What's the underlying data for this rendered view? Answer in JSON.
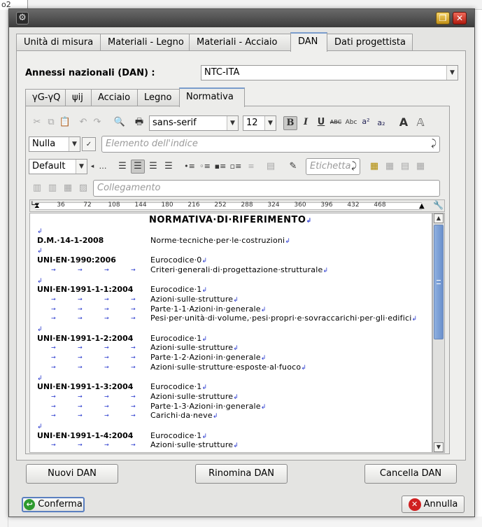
{
  "background": {
    "tab_text": "o2"
  },
  "window": {
    "icons": {
      "app": "gear-icon",
      "restore": "restore-icon",
      "close": "close-icon"
    },
    "colors": {
      "accent": "#7a9ccc",
      "thumb": "#6a90cc",
      "ok_icon": "#2e9a2e",
      "cancel_icon": "#d02020",
      "pilcrow": "#2233cc"
    }
  },
  "outer_tabs": [
    "Unità di misura",
    "Materiali - Legno",
    "Materiali - Acciaio",
    "DAN",
    "Dati progettista"
  ],
  "outer_active": "DAN",
  "annex": {
    "label": "Annessi nazionali (DAN) :",
    "value": "NTC-ITA"
  },
  "inner_tabs": [
    "γG-γQ",
    "ψij",
    "Acciaio",
    "Legno",
    "Normativa"
  ],
  "inner_active": "Normativa",
  "toolbar": {
    "font_family": "sans-serif",
    "font_size": "12",
    "bold": "B",
    "italic": "I",
    "underline": "U",
    "strike": "ABC",
    "smallcaps": "Abc",
    "superscript": "a²",
    "subscript": "a₂",
    "style": "Nulla",
    "index_placeholder": "Elemento dell'indice",
    "paragraph_style": "Default",
    "label_placeholder": "Etichetta",
    "link_placeholder": "Collegamento"
  },
  "ruler": {
    "ticks": [
      "36",
      "72",
      "108",
      "144",
      "180",
      "216",
      "252",
      "288",
      "324",
      "360",
      "396",
      "432",
      "468"
    ]
  },
  "document": {
    "title": "NORMATIVA·DI·RIFERIMENTO",
    "entries": [
      {
        "code": "D.M.·14-1-2008",
        "lines": [
          "Norme·tecniche·per·le·costruzioni"
        ]
      },
      {
        "code": "UNI·EN·1990:2006",
        "lines": [
          "Eurocodice·0",
          "Criteri·generali·di·progettazione·strutturale"
        ]
      },
      {
        "code": "UNI·EN·1991-1-1:2004",
        "lines": [
          "Eurocodice·1",
          "Azioni·sulle·strutture",
          "Parte·1-1·Azioni·in·generale",
          "Pesi·per·unità·di·volume,·pesi·propri·e·sovraccarichi·per·gli·edifici"
        ]
      },
      {
        "code": "UNI·EN·1991-1-2:2004",
        "lines": [
          "Eurocodice·1",
          "Azioni·sulle·strutture",
          "Parte·1-2·Azioni·in·generale",
          "Azioni·sulle·strutture·esposte·al·fuoco"
        ]
      },
      {
        "code": "UNI·EN·1991-1-3:2004",
        "lines": [
          "Eurocodice·1",
          "Azioni·sulle·strutture",
          "Parte·1-3·Azioni·in·generale",
          "Carichi·da·neve"
        ]
      },
      {
        "code": "UNI·EN·1991-1-4:2004",
        "lines": [
          "Eurocodice·1",
          "Azioni·sulle·strutture"
        ]
      }
    ]
  },
  "buttons": {
    "new": "Nuovi DAN",
    "rename": "Rinomina DAN",
    "delete": "Cancella DAN",
    "confirm": "Conferma",
    "cancel": "Annulla"
  }
}
